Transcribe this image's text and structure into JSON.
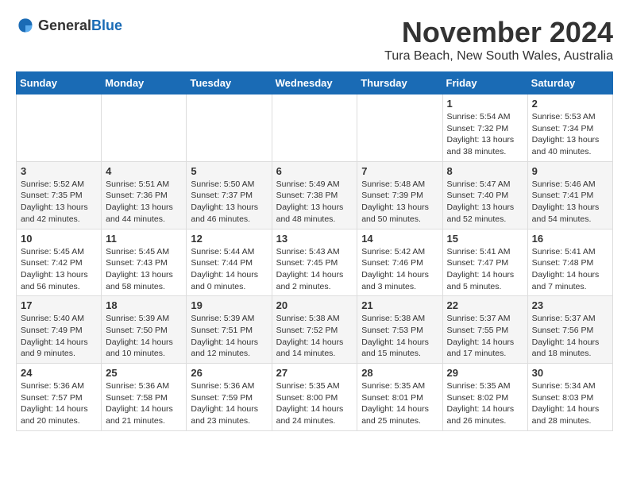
{
  "logo": {
    "text_general": "General",
    "text_blue": "Blue"
  },
  "title": "November 2024",
  "location": "Tura Beach, New South Wales, Australia",
  "weekdays": [
    "Sunday",
    "Monday",
    "Tuesday",
    "Wednesday",
    "Thursday",
    "Friday",
    "Saturday"
  ],
  "weeks": [
    [
      {
        "day": "",
        "sunrise": "",
        "sunset": "",
        "daylight": ""
      },
      {
        "day": "",
        "sunrise": "",
        "sunset": "",
        "daylight": ""
      },
      {
        "day": "",
        "sunrise": "",
        "sunset": "",
        "daylight": ""
      },
      {
        "day": "",
        "sunrise": "",
        "sunset": "",
        "daylight": ""
      },
      {
        "day": "",
        "sunrise": "",
        "sunset": "",
        "daylight": ""
      },
      {
        "day": "1",
        "sunrise": "Sunrise: 5:54 AM",
        "sunset": "Sunset: 7:32 PM",
        "daylight": "Daylight: 13 hours and 38 minutes."
      },
      {
        "day": "2",
        "sunrise": "Sunrise: 5:53 AM",
        "sunset": "Sunset: 7:34 PM",
        "daylight": "Daylight: 13 hours and 40 minutes."
      }
    ],
    [
      {
        "day": "3",
        "sunrise": "Sunrise: 5:52 AM",
        "sunset": "Sunset: 7:35 PM",
        "daylight": "Daylight: 13 hours and 42 minutes."
      },
      {
        "day": "4",
        "sunrise": "Sunrise: 5:51 AM",
        "sunset": "Sunset: 7:36 PM",
        "daylight": "Daylight: 13 hours and 44 minutes."
      },
      {
        "day": "5",
        "sunrise": "Sunrise: 5:50 AM",
        "sunset": "Sunset: 7:37 PM",
        "daylight": "Daylight: 13 hours and 46 minutes."
      },
      {
        "day": "6",
        "sunrise": "Sunrise: 5:49 AM",
        "sunset": "Sunset: 7:38 PM",
        "daylight": "Daylight: 13 hours and 48 minutes."
      },
      {
        "day": "7",
        "sunrise": "Sunrise: 5:48 AM",
        "sunset": "Sunset: 7:39 PM",
        "daylight": "Daylight: 13 hours and 50 minutes."
      },
      {
        "day": "8",
        "sunrise": "Sunrise: 5:47 AM",
        "sunset": "Sunset: 7:40 PM",
        "daylight": "Daylight: 13 hours and 52 minutes."
      },
      {
        "day": "9",
        "sunrise": "Sunrise: 5:46 AM",
        "sunset": "Sunset: 7:41 PM",
        "daylight": "Daylight: 13 hours and 54 minutes."
      }
    ],
    [
      {
        "day": "10",
        "sunrise": "Sunrise: 5:45 AM",
        "sunset": "Sunset: 7:42 PM",
        "daylight": "Daylight: 13 hours and 56 minutes."
      },
      {
        "day": "11",
        "sunrise": "Sunrise: 5:45 AM",
        "sunset": "Sunset: 7:43 PM",
        "daylight": "Daylight: 13 hours and 58 minutes."
      },
      {
        "day": "12",
        "sunrise": "Sunrise: 5:44 AM",
        "sunset": "Sunset: 7:44 PM",
        "daylight": "Daylight: 14 hours and 0 minutes."
      },
      {
        "day": "13",
        "sunrise": "Sunrise: 5:43 AM",
        "sunset": "Sunset: 7:45 PM",
        "daylight": "Daylight: 14 hours and 2 minutes."
      },
      {
        "day": "14",
        "sunrise": "Sunrise: 5:42 AM",
        "sunset": "Sunset: 7:46 PM",
        "daylight": "Daylight: 14 hours and 3 minutes."
      },
      {
        "day": "15",
        "sunrise": "Sunrise: 5:41 AM",
        "sunset": "Sunset: 7:47 PM",
        "daylight": "Daylight: 14 hours and 5 minutes."
      },
      {
        "day": "16",
        "sunrise": "Sunrise: 5:41 AM",
        "sunset": "Sunset: 7:48 PM",
        "daylight": "Daylight: 14 hours and 7 minutes."
      }
    ],
    [
      {
        "day": "17",
        "sunrise": "Sunrise: 5:40 AM",
        "sunset": "Sunset: 7:49 PM",
        "daylight": "Daylight: 14 hours and 9 minutes."
      },
      {
        "day": "18",
        "sunrise": "Sunrise: 5:39 AM",
        "sunset": "Sunset: 7:50 PM",
        "daylight": "Daylight: 14 hours and 10 minutes."
      },
      {
        "day": "19",
        "sunrise": "Sunrise: 5:39 AM",
        "sunset": "Sunset: 7:51 PM",
        "daylight": "Daylight: 14 hours and 12 minutes."
      },
      {
        "day": "20",
        "sunrise": "Sunrise: 5:38 AM",
        "sunset": "Sunset: 7:52 PM",
        "daylight": "Daylight: 14 hours and 14 minutes."
      },
      {
        "day": "21",
        "sunrise": "Sunrise: 5:38 AM",
        "sunset": "Sunset: 7:53 PM",
        "daylight": "Daylight: 14 hours and 15 minutes."
      },
      {
        "day": "22",
        "sunrise": "Sunrise: 5:37 AM",
        "sunset": "Sunset: 7:55 PM",
        "daylight": "Daylight: 14 hours and 17 minutes."
      },
      {
        "day": "23",
        "sunrise": "Sunrise: 5:37 AM",
        "sunset": "Sunset: 7:56 PM",
        "daylight": "Daylight: 14 hours and 18 minutes."
      }
    ],
    [
      {
        "day": "24",
        "sunrise": "Sunrise: 5:36 AM",
        "sunset": "Sunset: 7:57 PM",
        "daylight": "Daylight: 14 hours and 20 minutes."
      },
      {
        "day": "25",
        "sunrise": "Sunrise: 5:36 AM",
        "sunset": "Sunset: 7:58 PM",
        "daylight": "Daylight: 14 hours and 21 minutes."
      },
      {
        "day": "26",
        "sunrise": "Sunrise: 5:36 AM",
        "sunset": "Sunset: 7:59 PM",
        "daylight": "Daylight: 14 hours and 23 minutes."
      },
      {
        "day": "27",
        "sunrise": "Sunrise: 5:35 AM",
        "sunset": "Sunset: 8:00 PM",
        "daylight": "Daylight: 14 hours and 24 minutes."
      },
      {
        "day": "28",
        "sunrise": "Sunrise: 5:35 AM",
        "sunset": "Sunset: 8:01 PM",
        "daylight": "Daylight: 14 hours and 25 minutes."
      },
      {
        "day": "29",
        "sunrise": "Sunrise: 5:35 AM",
        "sunset": "Sunset: 8:02 PM",
        "daylight": "Daylight: 14 hours and 26 minutes."
      },
      {
        "day": "30",
        "sunrise": "Sunrise: 5:34 AM",
        "sunset": "Sunset: 8:03 PM",
        "daylight": "Daylight: 14 hours and 28 minutes."
      }
    ]
  ]
}
